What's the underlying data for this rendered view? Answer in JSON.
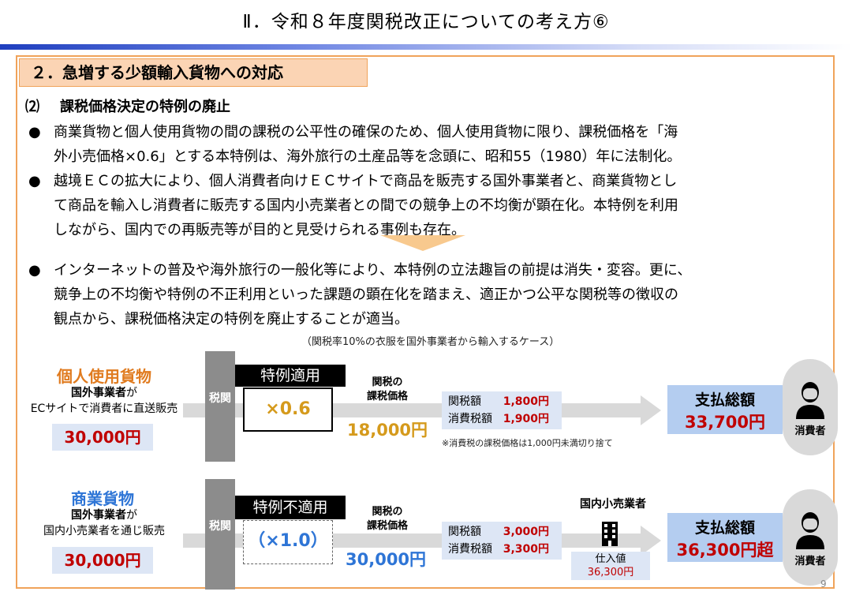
{
  "title": "Ⅱ．令和８年度関税改正についての考え方⑥",
  "section_heading": "２．急増する少額輸入貨物への対応",
  "subsection": {
    "number": "⑵",
    "label": "課税価格決定の特例の廃止"
  },
  "bullets": [
    {
      "lines": [
        "商業貨物と個人使用貨物の間の課税の公平性の確保のため、個人使用貨物に限り、課税価格を「海",
        "外小売価格×0.6」とする本特例は、海外旅行の土産品等を念頭に、昭和55（1980）年に法制化。"
      ]
    },
    {
      "lines": [
        "越境ＥＣの拡大により、個人消費者向けＥＣサイトで商品を販売する国外事業者と、商業貨物とし",
        "て商品を輸入し消費者に販売する国内小売業者との間での競争上の不均衡が顕在化。本特例を利用",
        "しながら、国内での再販売等が目的と見受けられる事例も存在。"
      ]
    },
    {
      "lines": [
        "インターネットの普及や海外旅行の一般化等により、本特例の立法趣旨の前提は消失・変容。更に、",
        "競争上の不均衡や特例の不正利用といった課題の顕在化を踏まえ、適正かつ公平な関税等の徴収の",
        "観点から、課税価格決定の特例を廃止することが適当。"
      ]
    }
  ],
  "bullet_symbol": "●",
  "case_note": "（関税率10%の衣服を国外事業者から輸入するケース）",
  "pillar_label": "税関",
  "personal": {
    "category": "個人使用貨物",
    "line1_bold": "国外事業者",
    "line1_rest": "が",
    "line2": "ECサイトで消費者に直送販売",
    "price": "30,000円",
    "rule_label": "特例適用",
    "multiplier": "×0.6",
    "taxable_label_1": "関税の",
    "taxable_label_2": "課税価格",
    "taxable_value": "18,000円",
    "customs_duty_label": "関税額",
    "customs_duty": "1,800円",
    "consumption_tax_label": "消費税額",
    "consumption_tax": "1,900円",
    "rounding_note": "※消費税の課税価格は1,000円未満切り捨て",
    "payment_label": "支払総額",
    "payment_total": "33,700円",
    "consumer_label": "消費者"
  },
  "commercial": {
    "category": "商業貨物",
    "line1_bold": "国外事業者",
    "line1_rest": "が",
    "line2": "国内小売業者を通じ販売",
    "price": "30,000円",
    "rule_label": "特例不適用",
    "multiplier": "（×1.0）",
    "taxable_label_1": "関税の",
    "taxable_label_2": "課税価格",
    "taxable_value": "30,000円",
    "customs_duty_label": "関税額",
    "customs_duty": "3,000円",
    "consumption_tax_label": "消費税額",
    "consumption_tax": "3,300円",
    "retailer_label": "国内小売業者",
    "purchase_label": "仕入値",
    "purchase_value": "36,300円",
    "payment_label": "支払総額",
    "payment_total": "36,300円超",
    "consumer_label": "消費者"
  },
  "page_number": "9",
  "colors": {
    "accent_orange": "#f0a35a",
    "price_red": "#c00000",
    "category_orange": "#e07b1f",
    "category_blue": "#2e75d6",
    "title_bar_blue": "#1f3fbf"
  },
  "icons": {
    "person": "person-icon",
    "building": "building-icon"
  }
}
